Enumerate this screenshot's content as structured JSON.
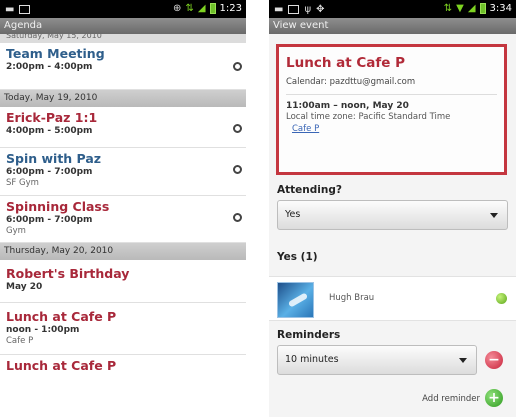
{
  "left": {
    "status": {
      "time": "1:23"
    },
    "title": "Agenda",
    "partial_header": "Saturday, May 15, 2010",
    "events": [
      {
        "title": "Team Meeting",
        "time": "2:00pm - 4:00pm",
        "location": "",
        "color": "blue",
        "alarm": true
      },
      {
        "header": "Today, May 19, 2010"
      },
      {
        "title": "Erick-Paz 1:1",
        "time": "4:00pm - 5:00pm",
        "location": "",
        "color": "red",
        "alarm": true
      },
      {
        "title": "Spin with Paz",
        "time": "6:00pm - 7:00pm",
        "location": "SF Gym",
        "color": "blue",
        "alarm": true
      },
      {
        "title": "Spinning Class",
        "time": "6:00pm - 7:00pm",
        "location": "Gym",
        "color": "red",
        "alarm": true
      },
      {
        "header": "Thursday, May 20, 2010"
      },
      {
        "title": "Robert's Birthday",
        "time": "May 20",
        "location": "",
        "color": "red",
        "alarm": false
      },
      {
        "title": "Lunch at Cafe P",
        "time": "noon - 1:00pm",
        "location": "Cafe P",
        "color": "red",
        "alarm": false
      },
      {
        "title": "Lunch at Cafe P",
        "time": "",
        "location": "",
        "color": "red",
        "alarm": false
      }
    ]
  },
  "right": {
    "status": {
      "time": "3:34"
    },
    "title": "View event",
    "event": {
      "title": "Lunch at Cafe P",
      "calendar": "Calendar: pazdttu@gmail.com",
      "when": "11:00am – noon, May 20",
      "timezone": "Local time zone: Pacific Standard Time",
      "location_link": "Cafe P"
    },
    "attending": {
      "label": "Attending?",
      "value": "Yes"
    },
    "attendees": {
      "label": "Yes (1)",
      "list": [
        {
          "name": "Hugh Brau"
        }
      ]
    },
    "reminders": {
      "label": "Reminders",
      "value": "10 minutes",
      "add_label": "Add reminder"
    }
  },
  "colors": {
    "event_blue": "#2e5e8b",
    "event_red": "#a8283a",
    "card_border": "#c4363f",
    "link": "#3a66b6",
    "status_green": "#5ba51a"
  }
}
